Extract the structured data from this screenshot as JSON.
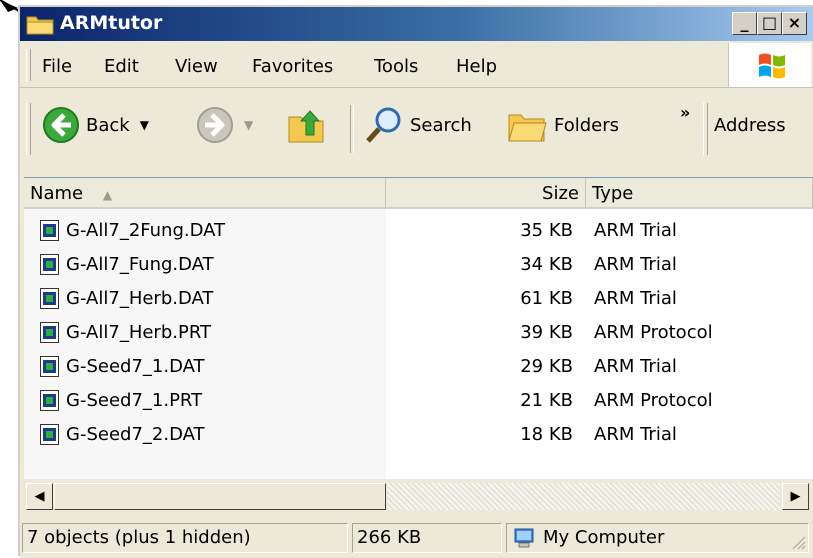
{
  "window": {
    "title": "ARMtutor"
  },
  "title_buttons": {
    "minimize": "_",
    "maximize": "□",
    "close": "×"
  },
  "menu": [
    {
      "label": "File"
    },
    {
      "label": "Edit"
    },
    {
      "label": "View"
    },
    {
      "label": "Favorites"
    },
    {
      "label": "Tools"
    },
    {
      "label": "Help"
    }
  ],
  "toolbar": {
    "back": "Back",
    "search": "Search",
    "folders": "Folders",
    "more": "»",
    "address": "Address"
  },
  "columns": {
    "name": "Name",
    "size": "Size",
    "type": "Type"
  },
  "files": [
    {
      "name": "G-All7_2Fung.DAT",
      "size": "35 KB",
      "type": "ARM Trial"
    },
    {
      "name": "G-All7_Fung.DAT",
      "size": "34 KB",
      "type": "ARM Trial"
    },
    {
      "name": "G-All7_Herb.DAT",
      "size": "61 KB",
      "type": "ARM Trial"
    },
    {
      "name": "G-All7_Herb.PRT",
      "size": "39 KB",
      "type": "ARM Protocol"
    },
    {
      "name": "G-Seed7_1.DAT",
      "size": "29 KB",
      "type": "ARM Trial"
    },
    {
      "name": "G-Seed7_1.PRT",
      "size": "21 KB",
      "type": "ARM Protocol"
    },
    {
      "name": "G-Seed7_2.DAT",
      "size": "18 KB",
      "type": "ARM Trial"
    }
  ],
  "status": {
    "objects": "7 objects (plus 1 hidden)",
    "size": "266 KB",
    "location": "My Computer"
  },
  "colors": {
    "title_start": "#0a246a",
    "title_end": "#a6caf0",
    "face": "#ece9d8"
  }
}
